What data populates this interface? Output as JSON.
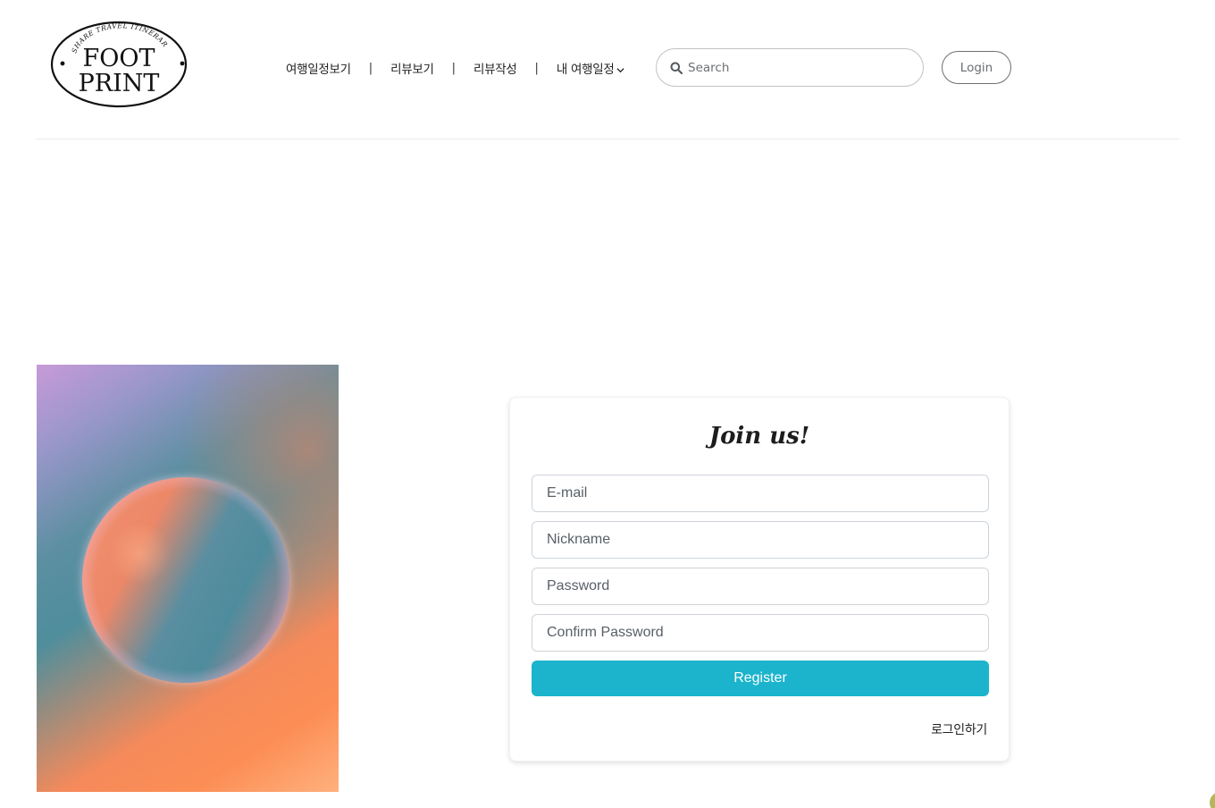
{
  "logo": {
    "arc_text": "SHARE TRAVEL ITINERARY",
    "line1": "FOOT",
    "line2": "PRINT"
  },
  "nav": {
    "items": [
      {
        "label": "여행일정보기"
      },
      {
        "label": "리뷰보기"
      },
      {
        "label": "리뷰작성"
      },
      {
        "label": "내 여행일정"
      }
    ],
    "separator": "|"
  },
  "search": {
    "placeholder": "Search"
  },
  "header": {
    "login_label": "Login"
  },
  "register": {
    "title": "Join us!",
    "fields": {
      "email_placeholder": "E-mail",
      "nickname_placeholder": "Nickname",
      "password_placeholder": "Password",
      "confirm_placeholder": "Confirm Password"
    },
    "submit_label": "Register",
    "login_link": "로그인하기"
  },
  "colors": {
    "accent": "#1bb4cc",
    "divider": "#e9ebee"
  }
}
